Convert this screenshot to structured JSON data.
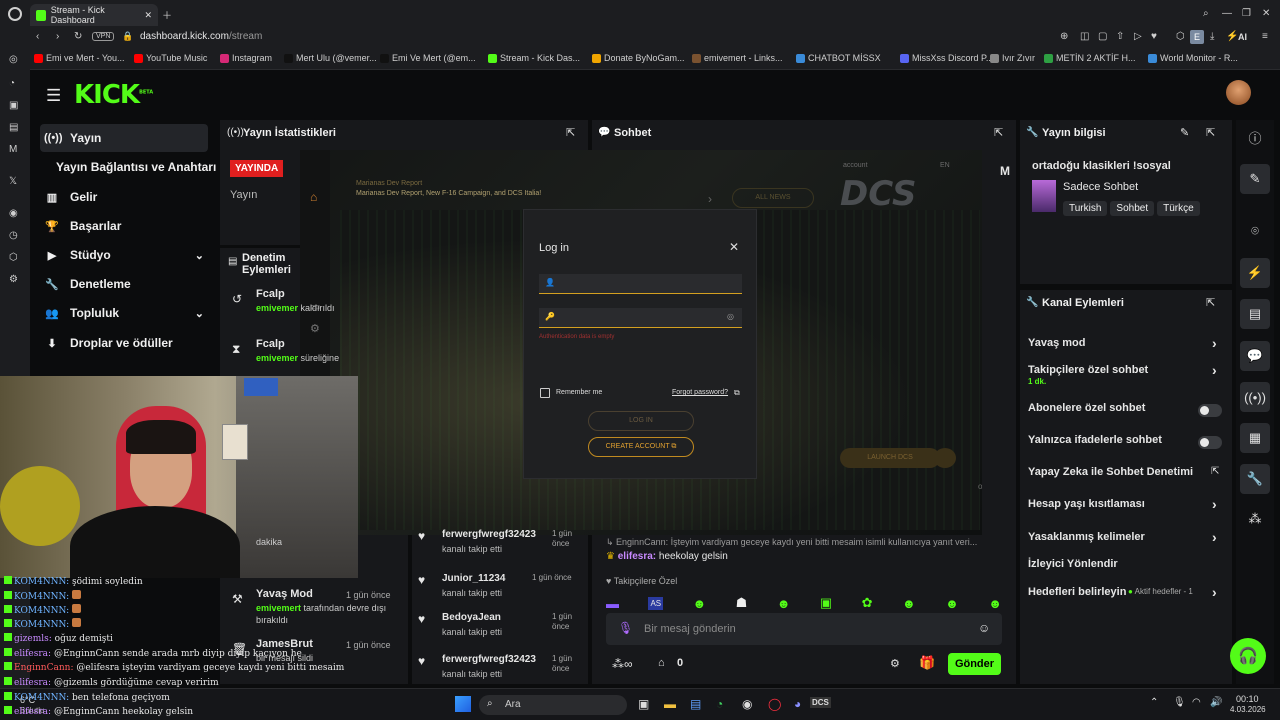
{
  "browser": {
    "tab_title": "Stream - Kick Dashboard",
    "url_domain": "dashboard.kick.com",
    "url_path": "/stream",
    "vpn_label": "VPN",
    "ai_label": "AI",
    "profile_letter": "E",
    "bookmarks": [
      {
        "label": "Emi ve Mert - You...",
        "color": "#ff0000"
      },
      {
        "label": "YouTube Music",
        "color": "#ff0000"
      },
      {
        "label": "Instagram",
        "color": "#d62976"
      },
      {
        "label": "Mert Ulu (@vemer...",
        "color": "#111111"
      },
      {
        "label": "Emi Ve Mert (@em...",
        "color": "#111111"
      },
      {
        "label": "Stream - Kick Das...",
        "color": "#53fc18"
      },
      {
        "label": "Donate ByNoGam...",
        "color": "#f0a500"
      },
      {
        "label": "emivemert - Links...",
        "color": "#7a5230"
      },
      {
        "label": "CHATBOT MİSSX",
        "color": "#3a8bd8"
      },
      {
        "label": "MissXss Discord P...",
        "color": "#5865f2"
      },
      {
        "label": "Ivır Zıvır",
        "color": "#888888"
      },
      {
        "label": "METİN 2 AKTİF H...",
        "color": "#2ea043"
      },
      {
        "label": "World Monitor - R...",
        "color": "#3a8bd8"
      }
    ]
  },
  "kick": {
    "logo": "KICK",
    "beta": "BETA"
  },
  "sidebar": {
    "items": [
      {
        "label": "Yayın",
        "icon": "broadcast-icon"
      },
      {
        "label": "Yayın Bağlantısı ve Anahtarı",
        "icon": ""
      },
      {
        "label": "Gelir",
        "icon": "chart-icon"
      },
      {
        "label": "Başarılar",
        "icon": "trophy-icon"
      },
      {
        "label": "Stüdyo",
        "icon": "video-icon"
      },
      {
        "label": "Denetleme",
        "icon": "wrench-icon"
      },
      {
        "label": "Topluluk",
        "icon": "users-icon"
      },
      {
        "label": "Droplar ve ödüller",
        "icon": "drops-icon"
      }
    ]
  },
  "stats": {
    "title": "Yayın İstatistikleri",
    "live_badge": "YAYINDA",
    "label": "Yayın"
  },
  "mod_actions": {
    "title": "Denetim Eylemleri",
    "items": [
      {
        "user": "Fcalp",
        "actor": "emivemer",
        "text": "kaldırıldı",
        "time": ""
      },
      {
        "user": "Fcalp",
        "actor": "emivemer",
        "text": "süreliğine",
        "time": ""
      },
      {
        "user": "",
        "actor": "",
        "text": "dakika",
        "time": ""
      },
      {
        "user": "Yavaş Mod",
        "actor": "emivemert",
        "text": "tarafından devre dışı bırakıldı",
        "time": "1 gün önce"
      },
      {
        "user": "JamesBrut",
        "actor": "",
        "text": "bir mesajı sildi",
        "time": "1 gün önce"
      }
    ]
  },
  "activity": {
    "items": [
      {
        "user": "ferwergfwregf32423",
        "text": "kanalı takip etti",
        "time": "1 gün önce"
      },
      {
        "user": "Junior_11234",
        "text": "kanalı takip etti",
        "time": "1 gün önce"
      },
      {
        "user": "BedoyaJean",
        "text": "kanalı takip etti",
        "time": "1 gün önce"
      },
      {
        "user": "ferwergfwregf32423",
        "text": "kanalı takip etti",
        "time": "1 gün önce"
      }
    ]
  },
  "chat": {
    "title": "Sohbet",
    "reply_note": "EnginnCann: İşteyim vardiyam geceye kaydı yeni bitti mesaim isimli kullanıcıya yanıt veri...",
    "last_user": "elifesra",
    "last_msg": "heekolay gelsin",
    "followers_only": "Takipçilere Özel",
    "input_placeholder": "Bir mesaj gönderin",
    "count": "0",
    "send": "Gönder",
    "m_label": "M"
  },
  "stream_info": {
    "title": "Yayın bilgisi",
    "stream_title": "ortadoğu klasikleri !sosyal",
    "category": "Sadece Sohbet",
    "tags": [
      "Turkish",
      "Sohbet",
      "Türkçe"
    ]
  },
  "channel_actions": {
    "title": "Kanal Eylemleri",
    "items": [
      {
        "label": "Yavaş mod",
        "sub": "",
        "control": "chevron"
      },
      {
        "label": "Takipçilere özel sohbet",
        "sub": "1 dk.",
        "control": "chevron"
      },
      {
        "label": "Abonelere özel sohbet",
        "sub": "",
        "control": "toggle"
      },
      {
        "label": "Yalnızca ifadelerle sohbet",
        "sub": "",
        "control": "toggle"
      },
      {
        "label": "Yapay Zeka ile Sohbet Denetimi",
        "sub": "",
        "control": "external"
      },
      {
        "label": "Hesap yaşı kısıtlaması",
        "sub": "",
        "control": "chevron"
      },
      {
        "label": "Yasaklanmış kelimeler",
        "sub": "",
        "control": "chevron"
      },
      {
        "label": "İzleyici Yönlendir",
        "sub": "",
        "control": "none"
      },
      {
        "label": "Hedefleri belirleyin",
        "sub": "Aktif hedefler - 1",
        "control": "chevron"
      }
    ]
  },
  "dcs": {
    "news1": "Marianas Dev Report",
    "news2": "Marianas Dev Report, New F-16 Campaign, and DCS Italia!",
    "all_news": "ALL NEWS",
    "logo": "DCS",
    "account": "account",
    "lang": "EN",
    "launch": "LAUNCH DCS",
    "or": "or"
  },
  "login": {
    "title": "Log in",
    "error": "Authentication data is empty",
    "remember": "Remember me",
    "forgot": "Forgot password?",
    "login_btn": "LOG IN",
    "create_btn": "CREATE ACCOUNT"
  },
  "overlay_chat": [
    {
      "user": "KOM4NNN:",
      "msg": "şödimi soyledin",
      "color": "#6fb3ff"
    },
    {
      "user": "KOM4NNN:",
      "msg": "",
      "color": "#6fb3ff"
    },
    {
      "user": "KOM4NNN:",
      "msg": "",
      "color": "#6fb3ff"
    },
    {
      "user": "KOM4NNN:",
      "msg": "",
      "color": "#6fb3ff"
    },
    {
      "user": "gizemls:",
      "msg": "oğuz demişti",
      "color": "#c88aff"
    },
    {
      "user": "elifesra:",
      "msg": "@EnginnCann sende arada mrb diyip diyip kaçıyon he",
      "color": "#c88aff"
    },
    {
      "user": "EnginnCann:",
      "msg": "@elifesra işteyim vardiyam geceye kaydı yeni bitti mesaim",
      "color": "#ff5b5b"
    },
    {
      "user": "elifesra:",
      "msg": "@gizemls gördüğüme cevap veririm",
      "color": "#c88aff"
    },
    {
      "user": "KOM4NNN:",
      "msg": "ben telefona geçiyom",
      "color": "#6fb3ff"
    },
    {
      "user": "elifesra:",
      "msg": "@EnginnCann heekolay gelsin",
      "color": "#c88aff"
    }
  ],
  "taskbar": {
    "search": "Ara",
    "weather_temp": "6°C",
    "weather_desc": "Bulutlu",
    "time": "00:10",
    "date": "4.03.2026"
  }
}
